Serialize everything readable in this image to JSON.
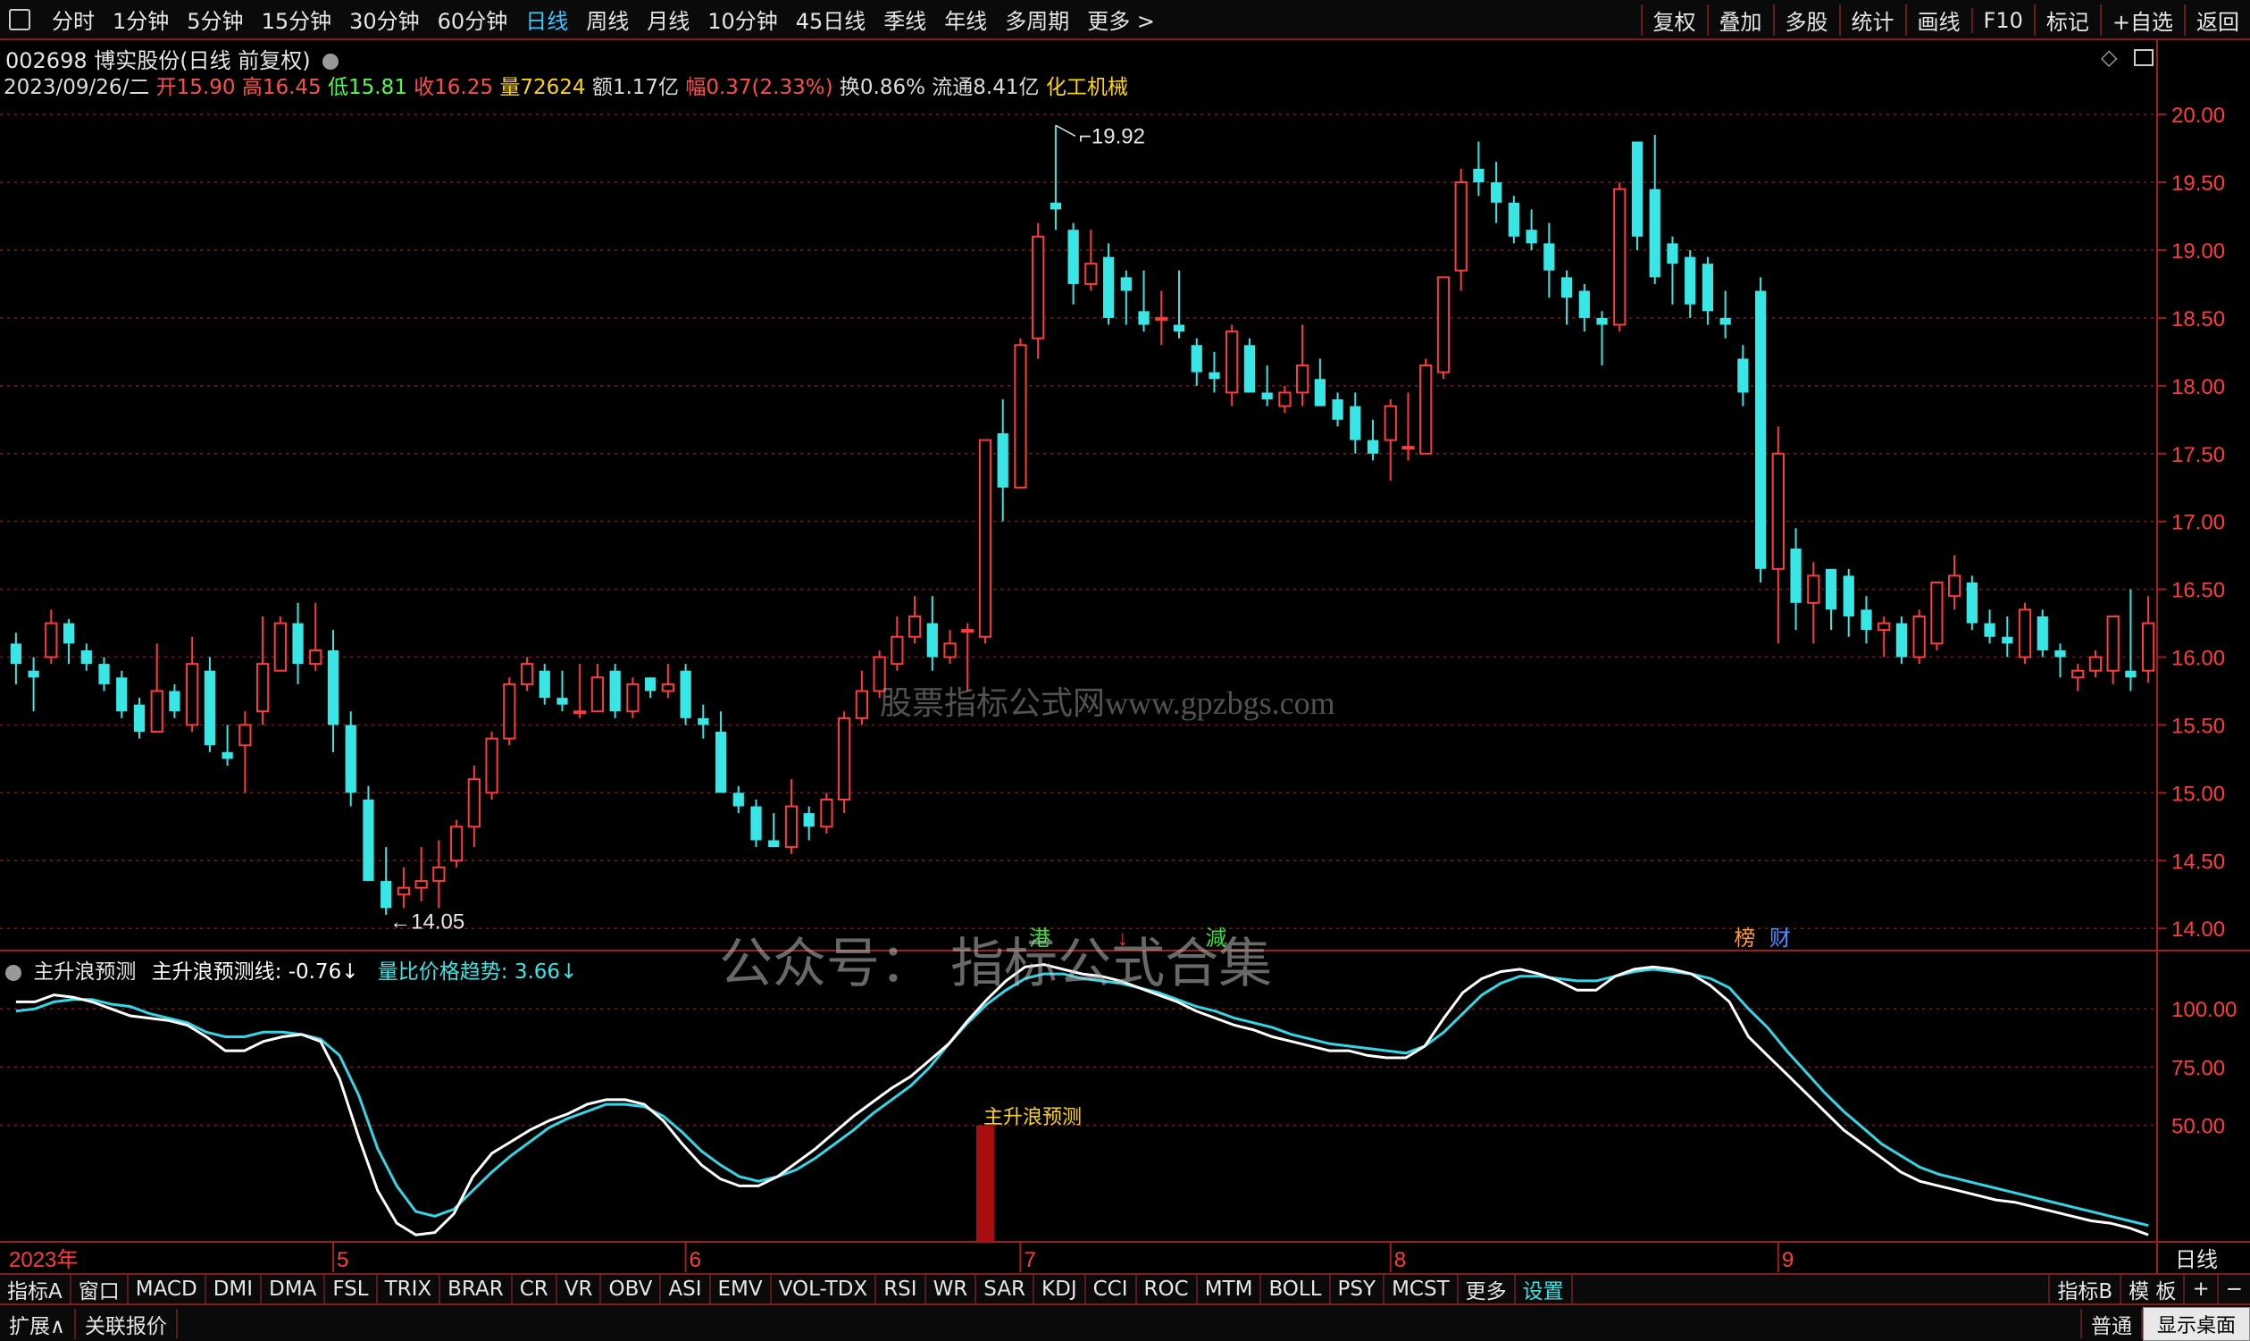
{
  "toolbar": {
    "periods": [
      "分时",
      "1分钟",
      "5分钟",
      "15分钟",
      "30分钟",
      "60分钟",
      "日线",
      "周线",
      "月线",
      "10分钟",
      "45日线",
      "季线",
      "年线",
      "多周期",
      "更多 >"
    ],
    "active_period": "日线",
    "right_buttons": [
      "复权",
      "叠加",
      "多股",
      "统计",
      "画线",
      "F10",
      "标记",
      "+自选",
      "返回"
    ]
  },
  "stock": {
    "header": "002698 博实股份(日线 前复权)",
    "date": "2023/09/26/二",
    "open_label": "开",
    "open": "15.90",
    "high_label": "高",
    "high": "16.45",
    "low_label": "低",
    "low": "15.81",
    "close_label": "收",
    "close": "16.25",
    "volume_label": "量",
    "volume": "72624",
    "amount_label": "额",
    "amount": "1.17亿",
    "change_label": "幅",
    "change": "0.37(2.33%)",
    "turnover_label": "换",
    "turnover": "0.86%",
    "float_label": "流通",
    "float": "8.41亿",
    "industry": "化工机械"
  },
  "indicator_header": {
    "name": "主升浪预测",
    "line1_label": "主升浪预测线:",
    "line1_value": "-0.76",
    "line2_label": "量比价格趋势:",
    "line2_value": "3.66"
  },
  "watermarks": {
    "site": "股票指标公式网www.gpzbgs.com",
    "wechat": "公众号：  指标公式合集"
  },
  "markers": {
    "hk": "港",
    "reduce": "減",
    "rank": "榜",
    "finance": "财",
    "signal": "主升浪预测",
    "high_note": "19.92",
    "low_note": "14.05"
  },
  "colors": {
    "up": "#ff3b3b",
    "down": "#39e6e6",
    "line_white": "#ffffff",
    "line_cyan": "#33d6e6",
    "grid": "#7a1a1a"
  },
  "chart_data": [
    {
      "type": "candlestick",
      "y_ticks": [
        20.0,
        19.5,
        19.0,
        18.5,
        18.0,
        17.5,
        17.0,
        16.5,
        16.0,
        15.5,
        15.0,
        14.5,
        14.0
      ],
      "ylim": [
        13.85,
        20.35
      ],
      "x_labels": [
        "2023年",
        "5",
        "6",
        "7",
        "8",
        "9"
      ],
      "x_label_index": [
        0,
        18,
        38,
        57,
        78,
        100
      ],
      "ohlc": [
        [
          16.1,
          16.18,
          15.8,
          15.95
        ],
        [
          15.9,
          16.0,
          15.6,
          15.85
        ],
        [
          16.0,
          16.35,
          15.95,
          16.25
        ],
        [
          16.25,
          16.28,
          15.95,
          16.1
        ],
        [
          16.05,
          16.1,
          15.9,
          15.95
        ],
        [
          15.95,
          16.0,
          15.75,
          15.8
        ],
        [
          15.85,
          15.9,
          15.55,
          15.6
        ],
        [
          15.65,
          15.7,
          15.4,
          15.45
        ],
        [
          15.45,
          16.1,
          15.45,
          15.75
        ],
        [
          15.75,
          15.8,
          15.55,
          15.6
        ],
        [
          15.5,
          16.15,
          15.45,
          15.95
        ],
        [
          15.9,
          16.0,
          15.3,
          15.35
        ],
        [
          15.3,
          15.5,
          15.2,
          15.25
        ],
        [
          15.35,
          15.6,
          15.0,
          15.5
        ],
        [
          15.6,
          16.3,
          15.5,
          15.95
        ],
        [
          15.9,
          16.3,
          15.9,
          16.25
        ],
        [
          16.25,
          16.4,
          15.8,
          15.95
        ],
        [
          15.95,
          16.4,
          15.9,
          16.05
        ],
        [
          16.05,
          16.2,
          15.3,
          15.5
        ],
        [
          15.5,
          15.6,
          14.9,
          15.0
        ],
        [
          14.95,
          15.05,
          14.35,
          14.35
        ],
        [
          14.35,
          14.6,
          14.1,
          14.15
        ],
        [
          14.25,
          14.45,
          14.15,
          14.3
        ],
        [
          14.3,
          14.6,
          14.2,
          14.35
        ],
        [
          14.35,
          14.65,
          14.15,
          14.45
        ],
        [
          14.5,
          14.8,
          14.45,
          14.75
        ],
        [
          14.75,
          15.2,
          14.6,
          15.1
        ],
        [
          15.0,
          15.45,
          14.95,
          15.4
        ],
        [
          15.4,
          15.85,
          15.35,
          15.8
        ],
        [
          15.8,
          16.0,
          15.75,
          15.95
        ],
        [
          15.9,
          15.95,
          15.65,
          15.7
        ],
        [
          15.7,
          15.9,
          15.6,
          15.65
        ],
        [
          15.6,
          15.95,
          15.55,
          15.6
        ],
        [
          15.6,
          15.95,
          15.6,
          15.85
        ],
        [
          15.9,
          15.95,
          15.55,
          15.6
        ],
        [
          15.6,
          15.85,
          15.55,
          15.8
        ],
        [
          15.85,
          15.85,
          15.7,
          15.75
        ],
        [
          15.75,
          15.95,
          15.7,
          15.8
        ],
        [
          15.9,
          15.95,
          15.5,
          15.55
        ],
        [
          15.55,
          15.65,
          15.4,
          15.5
        ],
        [
          15.45,
          15.6,
          15.0,
          15.0
        ],
        [
          15.0,
          15.05,
          14.85,
          14.9
        ],
        [
          14.9,
          14.95,
          14.6,
          14.65
        ],
        [
          14.65,
          14.85,
          14.6,
          14.6
        ],
        [
          14.6,
          15.1,
          14.55,
          14.9
        ],
        [
          14.85,
          14.9,
          14.65,
          14.75
        ],
        [
          14.75,
          15.0,
          14.7,
          14.95
        ],
        [
          14.95,
          15.6,
          14.85,
          15.55
        ],
        [
          15.55,
          15.9,
          15.5,
          15.75
        ],
        [
          15.75,
          16.05,
          15.7,
          16.0
        ],
        [
          15.95,
          16.3,
          15.9,
          16.15
        ],
        [
          16.15,
          16.45,
          16.1,
          16.3
        ],
        [
          16.25,
          16.45,
          15.9,
          16.0
        ],
        [
          16.0,
          16.2,
          15.95,
          16.1
        ],
        [
          16.2,
          16.25,
          15.75,
          16.2
        ],
        [
          16.15,
          17.45,
          16.1,
          17.6
        ],
        [
          17.65,
          17.9,
          17.0,
          17.25
        ],
        [
          17.25,
          18.35,
          17.25,
          18.3
        ],
        [
          18.35,
          19.2,
          18.2,
          19.1
        ],
        [
          19.35,
          19.92,
          19.15,
          19.3
        ],
        [
          19.15,
          19.2,
          18.6,
          18.75
        ],
        [
          18.75,
          19.15,
          18.7,
          18.9
        ],
        [
          18.95,
          19.05,
          18.45,
          18.5
        ],
        [
          18.8,
          18.85,
          18.45,
          18.7
        ],
        [
          18.55,
          18.85,
          18.4,
          18.45
        ],
        [
          18.5,
          18.7,
          18.3,
          18.5
        ],
        [
          18.45,
          18.85,
          18.35,
          18.4
        ],
        [
          18.3,
          18.35,
          18.0,
          18.1
        ],
        [
          18.1,
          18.25,
          17.95,
          18.05
        ],
        [
          17.95,
          18.45,
          17.85,
          18.4
        ],
        [
          18.3,
          18.35,
          17.95,
          17.95
        ],
        [
          17.95,
          18.15,
          17.85,
          17.9
        ],
        [
          17.85,
          18.0,
          17.8,
          17.95
        ],
        [
          17.95,
          18.45,
          17.85,
          18.15
        ],
        [
          18.05,
          18.2,
          17.9,
          17.85
        ],
        [
          17.9,
          17.95,
          17.7,
          17.75
        ],
        [
          17.85,
          17.95,
          17.5,
          17.6
        ],
        [
          17.6,
          17.75,
          17.45,
          17.5
        ],
        [
          17.6,
          17.9,
          17.3,
          17.85
        ],
        [
          17.55,
          17.95,
          17.45,
          17.55
        ],
        [
          17.5,
          18.2,
          17.5,
          18.15
        ],
        [
          18.1,
          18.8,
          18.05,
          18.8
        ],
        [
          18.85,
          19.6,
          18.7,
          19.5
        ],
        [
          19.6,
          19.8,
          19.4,
          19.5
        ],
        [
          19.5,
          19.65,
          19.2,
          19.35
        ],
        [
          19.35,
          19.4,
          19.05,
          19.1
        ],
        [
          19.15,
          19.3,
          19.0,
          19.05
        ],
        [
          19.05,
          19.2,
          18.65,
          18.85
        ],
        [
          18.8,
          18.85,
          18.45,
          18.65
        ],
        [
          18.7,
          18.75,
          18.4,
          18.5
        ],
        [
          18.5,
          18.55,
          18.15,
          18.45
        ],
        [
          18.45,
          19.5,
          18.4,
          19.45
        ],
        [
          19.8,
          19.8,
          19.0,
          19.1
        ],
        [
          19.45,
          19.85,
          18.75,
          18.8
        ],
        [
          19.05,
          19.1,
          18.6,
          18.9
        ],
        [
          18.95,
          19.0,
          18.5,
          18.6
        ],
        [
          18.9,
          18.95,
          18.45,
          18.55
        ],
        [
          18.5,
          18.7,
          18.35,
          18.45
        ],
        [
          18.2,
          18.3,
          17.85,
          17.95
        ],
        [
          18.7,
          18.8,
          16.55,
          16.65
        ],
        [
          16.65,
          17.7,
          16.1,
          17.5
        ],
        [
          16.8,
          16.95,
          16.2,
          16.4
        ],
        [
          16.4,
          16.7,
          16.1,
          16.6
        ],
        [
          16.65,
          16.65,
          16.2,
          16.35
        ],
        [
          16.6,
          16.65,
          16.15,
          16.3
        ],
        [
          16.35,
          16.45,
          16.1,
          16.2
        ],
        [
          16.2,
          16.3,
          16.0,
          16.25
        ],
        [
          16.25,
          16.3,
          15.95,
          16.0
        ],
        [
          16.0,
          16.35,
          15.95,
          16.3
        ],
        [
          16.1,
          16.5,
          16.05,
          16.55
        ],
        [
          16.45,
          16.75,
          16.35,
          16.6
        ],
        [
          16.55,
          16.6,
          16.2,
          16.25
        ],
        [
          16.25,
          16.35,
          16.1,
          16.15
        ],
        [
          16.15,
          16.3,
          16.0,
          16.1
        ],
        [
          16.0,
          16.4,
          15.95,
          16.35
        ],
        [
          16.3,
          16.35,
          16.0,
          16.05
        ],
        [
          16.05,
          16.1,
          15.85,
          16.0
        ],
        [
          15.85,
          15.95,
          15.75,
          15.9
        ],
        [
          15.9,
          16.05,
          15.85,
          16.0
        ],
        [
          15.9,
          16.3,
          15.8,
          16.3
        ],
        [
          15.9,
          16.5,
          15.75,
          15.85
        ],
        [
          15.9,
          16.45,
          15.81,
          16.25
        ]
      ],
      "high_point": {
        "index": 59,
        "value": 19.92
      },
      "low_point": {
        "index": 21,
        "value": 14.05
      },
      "event_markers": [
        {
          "index": 58,
          "label": "港"
        },
        {
          "index": 63,
          "label": "↓"
        },
        {
          "index": 68,
          "label": "減"
        },
        {
          "index": 98,
          "label": "榜"
        },
        {
          "index": 100,
          "label": "财"
        }
      ]
    },
    {
      "type": "line",
      "y_ticks": [
        100.0,
        75.0,
        50.0
      ],
      "ylim": [
        0,
        125
      ],
      "series": [
        {
          "name": "主升浪预测线",
          "values": [
            103,
            103,
            106,
            105,
            103,
            100,
            97,
            96,
            95,
            93,
            88,
            82,
            82,
            86,
            88,
            89,
            86,
            70,
            45,
            22,
            8,
            3,
            4,
            12,
            28,
            38,
            43,
            48,
            52,
            55,
            59,
            61,
            61,
            59,
            52,
            42,
            33,
            27,
            24,
            24,
            28,
            34,
            40,
            47,
            54,
            60,
            66,
            71,
            78,
            85,
            95,
            104,
            112,
            118,
            119,
            117,
            115,
            114,
            112,
            109,
            106,
            103,
            99,
            96,
            93,
            91,
            88,
            86,
            84,
            82,
            82,
            80,
            79,
            79,
            84,
            96,
            107,
            113,
            116,
            117,
            115,
            112,
            108,
            108,
            114,
            117,
            118,
            117,
            115,
            110,
            103,
            88,
            80,
            72,
            64,
            56,
            48,
            42,
            36,
            30,
            26,
            24,
            22,
            20,
            18,
            17,
            15,
            13,
            11,
            9,
            8,
            6,
            3
          ]
        },
        {
          "name": "量比价格趋势",
          "values": [
            99,
            100,
            103,
            104,
            104,
            102,
            101,
            98,
            96,
            94,
            90,
            88,
            88,
            90,
            90,
            89,
            87,
            80,
            63,
            40,
            24,
            13,
            11,
            14,
            22,
            30,
            37,
            43,
            49,
            53,
            56,
            59,
            59,
            58,
            54,
            47,
            39,
            33,
            28,
            26,
            28,
            31,
            36,
            42,
            48,
            55,
            61,
            67,
            75,
            85,
            94,
            102,
            108,
            113,
            115,
            115,
            113,
            112,
            111,
            109,
            107,
            104,
            101,
            99,
            96,
            94,
            92,
            89,
            87,
            85,
            84,
            83,
            82,
            81,
            84,
            90,
            98,
            106,
            111,
            114,
            114,
            113,
            112,
            112,
            114,
            116,
            117,
            116,
            115,
            113,
            109,
            100,
            92,
            82,
            73,
            64,
            56,
            49,
            42,
            37,
            32,
            29,
            27,
            25,
            23,
            21,
            19,
            17,
            15,
            13,
            11,
            9,
            7
          ]
        }
      ],
      "signal_bar": {
        "index": 55,
        "value": 50
      }
    }
  ]
}
